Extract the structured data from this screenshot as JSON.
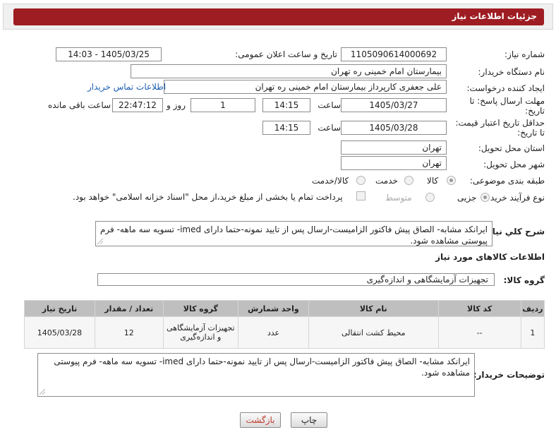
{
  "header": {
    "title": "جزئیات اطلاعات نیاز"
  },
  "form": {
    "need_number_label": "شماره نیاز:",
    "need_number": "1105090614000692",
    "announce_label": "تاریخ و ساعت اعلان عمومی:",
    "announce_value": "1405/03/25 - 14:03",
    "buyer_org_label": "نام دستگاه خریدار:",
    "buyer_org": "بیمارستان امام خمینی ره  تهران",
    "requester_label": "ایجاد کننده درخواست:",
    "requester": "علی جعفری کارپرداز بیمارستان امام خمینی ره  تهران",
    "contact_link": "اطلاعات تماس خریدار",
    "deadline_label_1": "مهلت ارسال پاسخ: تا",
    "deadline_label_2": "تاریخ:",
    "deadline_date": "1405/03/27",
    "time_label": "ساعت",
    "deadline_time": "14:15",
    "days_value": "1",
    "days_label": "روز و",
    "remaining_time": "22:47:12",
    "remaining_label": "ساعت باقی مانده",
    "validity_label_1": "حداقل تاریخ اعتبار قیمت:",
    "validity_label_2": "تا تاریخ:",
    "validity_date": "1405/03/28",
    "validity_time_label": "ساعت",
    "validity_time": "14:15",
    "province_label": "استان محل تحویل:",
    "province": "تهران",
    "city_label": "شهر محل تحویل:",
    "city": "تهران",
    "category_label": "طبقه بندی موضوعی:",
    "category_options": [
      "کالا",
      "خدمت",
      "کالا/خدمت"
    ],
    "process_label": "نوع فرآیند خرید :",
    "process_options": [
      "جزیی",
      "متوسط"
    ],
    "payment_note": "پرداخت تمام یا بخشی از مبلغ خرید،از محل \"اسناد خزانه اسلامی\" خواهد بود."
  },
  "description": {
    "label": "شرح کلي نياز:",
    "text": "ایرانکد مشابه- الصاق پیش فاکتور الزامیست-ارسال پس از تایید نمونه-حتما دارای imed- تسویه سه ماهه- فرم پیوستی مشاهده شود."
  },
  "goods_info_title": "اطلاعات کالاهای مورد نیاز",
  "goods_group": {
    "label": "گروه کالا:",
    "value": "تجهیزات آزمایشگاهی و اندازه‌گیری"
  },
  "table": {
    "headers": [
      "ردیف",
      "کد کالا",
      "نام کالا",
      "واحد شمارش",
      "گروه کالا",
      "تعداد / مقدار",
      "تاریخ نیاز"
    ],
    "rows": [
      {
        "row": "1",
        "code": "--",
        "name": "محیط کشت انتقالی",
        "unit": "عدد",
        "group": "تجهیزات آزمایشگاهی و اندازه‌گیری",
        "qty": "12",
        "date": "1405/03/28"
      }
    ]
  },
  "buyer_notes": {
    "label": "توضیحات خریدار:",
    "text": "ایرانکد مشابه- الصاق پیش فاکتور الزامیست-ارسال پس از تایید نمونه-حتما دارای imed- تسویه سه ماهه- فرم پیوستی مشاهده شود."
  },
  "buttons": {
    "print": "چاپ",
    "back": "بازگشت"
  },
  "colors": {
    "header_bar": "#9e1d22",
    "back_text": "#c0392b",
    "link": "#1a5fb4"
  }
}
